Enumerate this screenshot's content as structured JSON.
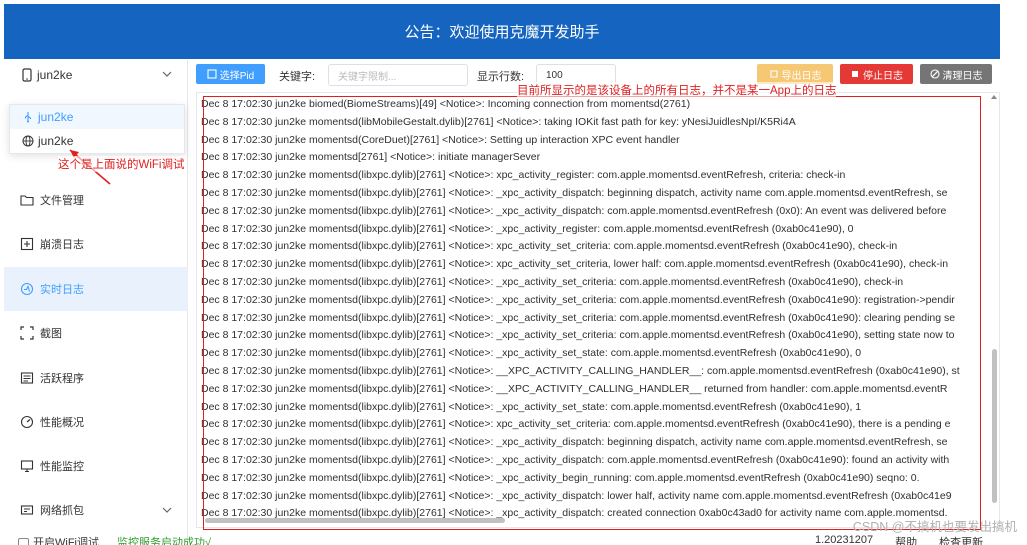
{
  "banner": {
    "text": "公告：欢迎使用克魔开发助手"
  },
  "sidebar": {
    "device_select": "jun2ke",
    "dropdown_options": [
      {
        "label": "jun2ke",
        "icon": "usb-icon"
      },
      {
        "label": "jun2ke",
        "icon": "globe-icon"
      }
    ],
    "items": [
      {
        "label": "文件管理",
        "icon": "folder-icon"
      },
      {
        "label": "崩溃日志",
        "icon": "crash-log-icon"
      },
      {
        "label": "实时日志",
        "icon": "realtime-log-icon"
      },
      {
        "label": "截图",
        "icon": "screenshot-icon"
      },
      {
        "label": "活跃程序",
        "icon": "app-list-icon"
      },
      {
        "label": "性能概况",
        "icon": "performance-icon"
      },
      {
        "label": "性能监控",
        "icon": "monitor-icon"
      },
      {
        "label": "网络抓包",
        "icon": "network-capture-icon"
      }
    ]
  },
  "toolbar": {
    "select_pid": "选择Pid",
    "keyword_label": "关键字:",
    "keyword_placeholder": "关键字限制...",
    "rows_label": "显示行数:",
    "rows_value": "100",
    "export_log": "导出日志",
    "stop_log": "停止日志",
    "clear_log": "清理日志"
  },
  "log_lines": [
    "Dec  8 17:02:30 jun2ke biomed(BiomeStreams)[49] <Notice>: Incoming connection from momentsd(2761)",
    "Dec  8 17:02:30 jun2ke momentsd(libMobileGestalt.dylib)[2761] <Notice>: taking IOKit fast path for key: yNesiJuidlesNpI/K5Ri4A",
    "Dec  8 17:02:30 jun2ke momentsd(CoreDuet)[2761] <Notice>: Setting up interaction XPC event handler",
    "Dec  8 17:02:30 jun2ke momentsd[2761] <Notice>: initiate managerSever",
    "Dec  8 17:02:30 jun2ke momentsd(libxpc.dylib)[2761] <Notice>: xpc_activity_register: com.apple.momentsd.eventRefresh, criteria: check-in",
    "Dec  8 17:02:30 jun2ke momentsd(libxpc.dylib)[2761] <Notice>: _xpc_activity_dispatch: beginning dispatch, activity name com.apple.momentsd.eventRefresh, se",
    "Dec  8 17:02:30 jun2ke momentsd(libxpc.dylib)[2761] <Notice>: _xpc_activity_dispatch: com.apple.momentsd.eventRefresh (0x0): An event was delivered before",
    "Dec  8 17:02:30 jun2ke momentsd(libxpc.dylib)[2761] <Notice>: _xpc_activity_register: com.apple.momentsd.eventRefresh (0xab0c41e90), 0",
    "Dec  8 17:02:30 jun2ke momentsd(libxpc.dylib)[2761] <Notice>: xpc_activity_set_criteria: com.apple.momentsd.eventRefresh (0xab0c41e90), check-in",
    "Dec  8 17:02:30 jun2ke momentsd(libxpc.dylib)[2761] <Notice>: xpc_activity_set_criteria, lower half: com.apple.momentsd.eventRefresh (0xab0c41e90), check-in",
    "Dec  8 17:02:30 jun2ke momentsd(libxpc.dylib)[2761] <Notice>: _xpc_activity_set_criteria: com.apple.momentsd.eventRefresh (0xab0c41e90), check-in",
    "Dec  8 17:02:30 jun2ke momentsd(libxpc.dylib)[2761] <Notice>: _xpc_activity_set_criteria: com.apple.momentsd.eventRefresh (0xab0c41e90): registration->pendir",
    "Dec  8 17:02:30 jun2ke momentsd(libxpc.dylib)[2761] <Notice>: _xpc_activity_set_criteria: com.apple.momentsd.eventRefresh (0xab0c41e90): clearing pending se",
    "Dec  8 17:02:30 jun2ke momentsd(libxpc.dylib)[2761] <Notice>: _xpc_activity_set_criteria: com.apple.momentsd.eventRefresh (0xab0c41e90), setting state now to",
    "Dec  8 17:02:30 jun2ke momentsd(libxpc.dylib)[2761] <Notice>: _xpc_activity_set_state: com.apple.momentsd.eventRefresh (0xab0c41e90), 0",
    "Dec  8 17:02:30 jun2ke momentsd(libxpc.dylib)[2761] <Notice>: __XPC_ACTIVITY_CALLING_HANDLER__: com.apple.momentsd.eventRefresh (0xab0c41e90), st",
    "Dec  8 17:02:30 jun2ke momentsd(libxpc.dylib)[2761] <Notice>: __XPC_ACTIVITY_CALLING_HANDLER__ returned from handler: com.apple.momentsd.eventR",
    "Dec  8 17:02:30 jun2ke momentsd(libxpc.dylib)[2761] <Notice>: _xpc_activity_set_state: com.apple.momentsd.eventRefresh (0xab0c41e90), 1",
    "Dec  8 17:02:30 jun2ke momentsd(libxpc.dylib)[2761] <Notice>: xpc_activity_set_criteria: com.apple.momentsd.eventRefresh (0xab0c41e90), there is a pending e",
    "Dec  8 17:02:30 jun2ke momentsd(libxpc.dylib)[2761] <Notice>: _xpc_activity_dispatch: beginning dispatch, activity name com.apple.momentsd.eventRefresh, se",
    "Dec  8 17:02:30 jun2ke momentsd(libxpc.dylib)[2761] <Notice>: _xpc_activity_dispatch: com.apple.momentsd.eventRefresh (0xab0c41e90): found an activity with",
    "Dec  8 17:02:30 jun2ke momentsd(libxpc.dylib)[2761] <Notice>: _xpc_activity_begin_running: com.apple.momentsd.eventRefresh (0xab0c41e90) seqno: 0.",
    "Dec  8 17:02:30 jun2ke momentsd(libxpc.dylib)[2761] <Notice>: _xpc_activity_dispatch: lower half, activity name com.apple.momentsd.eventRefresh (0xab0c41e9",
    "Dec  8 17:02:30 jun2ke momentsd(libxpc.dylib)[2761] <Notice>: _xpc_activity_dispatch: created connection 0xab0c43ad0 for activity name com.apple.momentsd."
  ],
  "annotations": {
    "top_note": "目前所显示的是该设备上的所有日志，并不是某一App上的日志",
    "wifi_note": "这个是上面说的WiFi调试"
  },
  "statusbar": {
    "wifi_debug": "开启WiFi调试",
    "service_status": "监控服务启动成功√",
    "version": "1.20231207",
    "help": "帮助",
    "check_update": "检查更新"
  },
  "watermark": "CSDN @不搞机也要发出搞机",
  "colors": {
    "banner": "#1565c0",
    "primary": "#409eff",
    "export": "#f7c873",
    "stop": "#e53935",
    "clear": "#757575",
    "annotation": "#e02020"
  }
}
